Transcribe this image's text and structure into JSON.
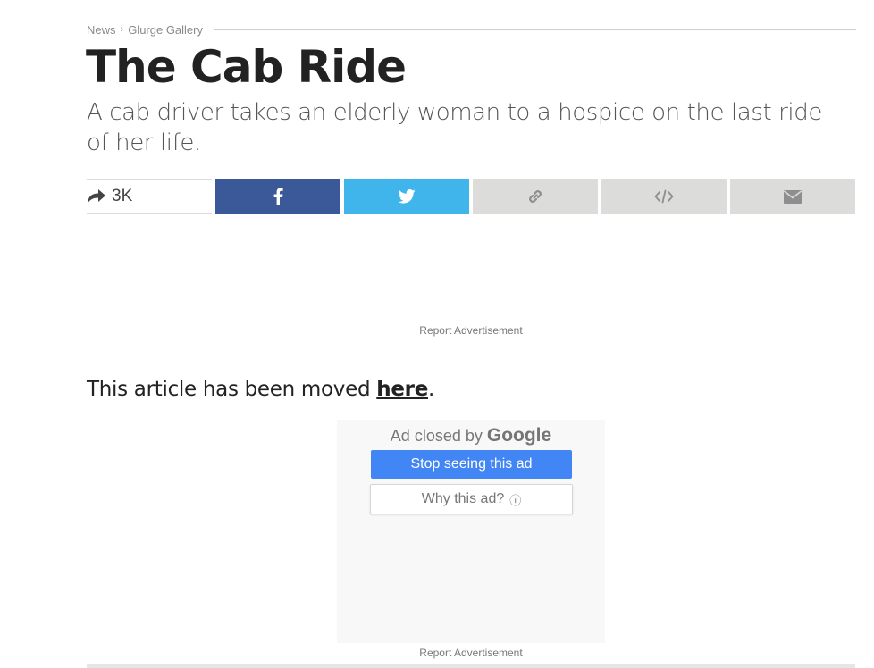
{
  "breadcrumb": {
    "items": [
      "News",
      "Glurge Gallery"
    ],
    "separator": "›"
  },
  "article": {
    "title": "The Cab Ride",
    "subtitle": "A cab driver takes an elderly woman to a hospice on the last ride of her life.",
    "moved_prefix": "This article has been moved ",
    "moved_link": "here",
    "moved_suffix": "."
  },
  "share": {
    "count": "3K",
    "buttons": [
      {
        "icon": "facebook-icon",
        "color": "#3b5998"
      },
      {
        "icon": "twitter-icon",
        "color": "#40b5ec"
      },
      {
        "icon": "link-icon",
        "color": "#dcdcda"
      },
      {
        "icon": "embed-code-icon",
        "color": "#dcdcda"
      },
      {
        "icon": "email-icon",
        "color": "#dcdcda"
      }
    ]
  },
  "ads": {
    "report_label": "Report Advertisement",
    "closed_prefix": "Ad closed by ",
    "closed_brand": "Google",
    "stop_label": "Stop seeing this ad",
    "why_label": "Why this ad?",
    "why_icon": "ⓘ",
    "stop_color": "#4285f4"
  }
}
